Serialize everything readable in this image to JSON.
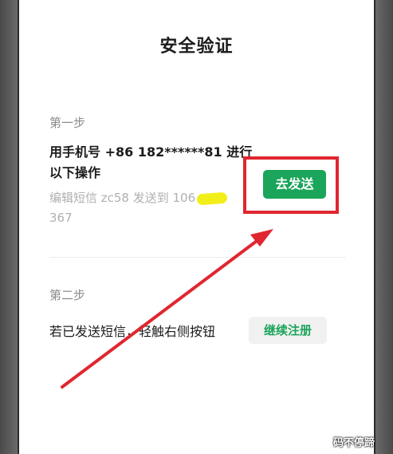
{
  "dialog": {
    "title": "安全验证"
  },
  "step1": {
    "label": "第一步",
    "instruction": "用手机号 +86 182******81 进行以下操作",
    "sms_prefix": "编辑短信 zc58 发送到 106",
    "sms_suffix": "367",
    "send_button": "去发送"
  },
  "step2": {
    "label": "第二步",
    "instruction": "若已发送短信，轻触右侧按钮",
    "continue_button": "继续注册"
  },
  "annotations": {
    "watermark": "码不停蹄",
    "highlight_color": "#e02630",
    "redaction_color": "#f2ee1a"
  },
  "colors": {
    "primary_green": "#1aa55a",
    "secondary_button_bg": "#f1f1f1"
  }
}
